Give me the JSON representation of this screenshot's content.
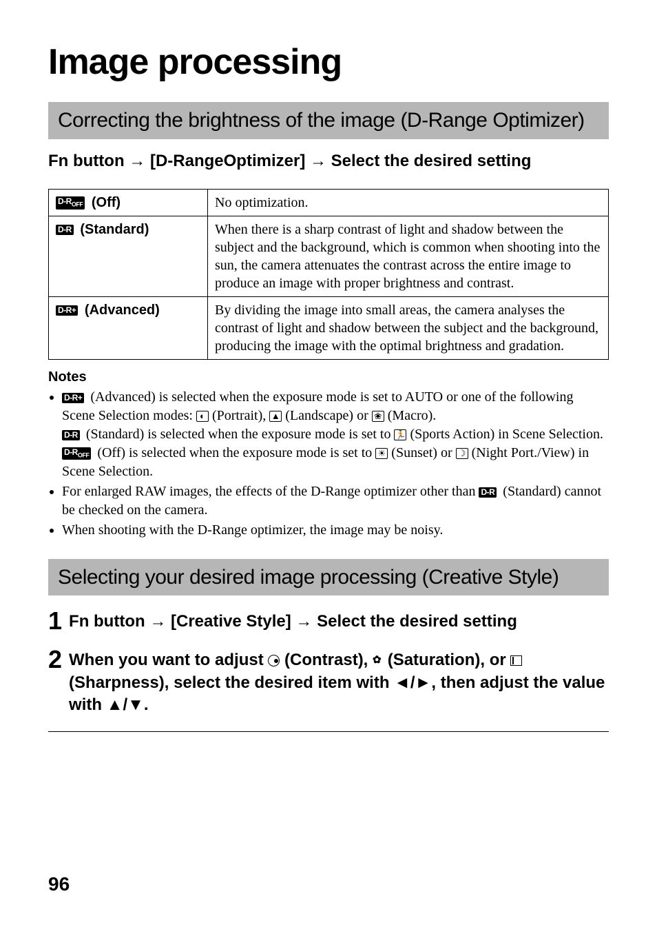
{
  "title": "Image processing",
  "section1_heading": "Correcting the brightness of the image (D-Range Optimizer)",
  "instruction1_prefix": "Fn button",
  "instruction1_mid": "[D-RangeOptimizer]",
  "instruction1_suffix": "Select the desired setting",
  "table": {
    "rows": [
      {
        "icon": "D-R OFF",
        "label": "(Off)",
        "desc": "No optimization."
      },
      {
        "icon": "D-R",
        "label": "(Standard)",
        "desc": "When there is a sharp contrast of light and shadow between the subject and the background, which is common when shooting into the sun, the camera attenuates the contrast across the entire image to produce an image with proper brightness and contrast."
      },
      {
        "icon": "D-R+",
        "label": "(Advanced)",
        "desc": "By dividing the image into small areas, the camera analyses the contrast of light and shadow between the subject and the background, producing the image with the optimal brightness and gradation."
      }
    ]
  },
  "notes_heading": "Notes",
  "notes": {
    "n1a": " (Advanced) is selected when the exposure mode is set to AUTO or one of the following Scene Selection modes: ",
    "n1_portrait": " (Portrait), ",
    "n1_landscape": " (Landscape) or ",
    "n1_macro": " (Macro).",
    "n1b_pre": " (Standard) is selected when the exposure mode is set to ",
    "n1b_sports": " (Sports Action) in Scene Selection.",
    "n1c_pre": " (Off) is selected when the exposure mode is set to ",
    "n1c_sunset": " (Sunset) or ",
    "n1c_night": " (Night Port./View) in Scene Selection.",
    "n2_pre": "For enlarged RAW images, the effects of the D-Range optimizer other than ",
    "n2_post": " (Standard) cannot be checked on the camera.",
    "n3": "When shooting with the D-Range optimizer, the image may be noisy."
  },
  "section2_heading": "Selecting your desired image processing (Creative Style)",
  "step1_prefix": "Fn button",
  "step1_mid": "[Creative Style]",
  "step1_suffix": "Select the desired setting",
  "step2_a": "When you want to adjust ",
  "step2_contrast": " (Contrast), ",
  "step2_saturation": " (Saturation), or ",
  "step2_sharpness": " (Sharpness), select the desired item with ",
  "step2_b": ", then adjust the value with ",
  "step2_end": ".",
  "page_number": "96"
}
